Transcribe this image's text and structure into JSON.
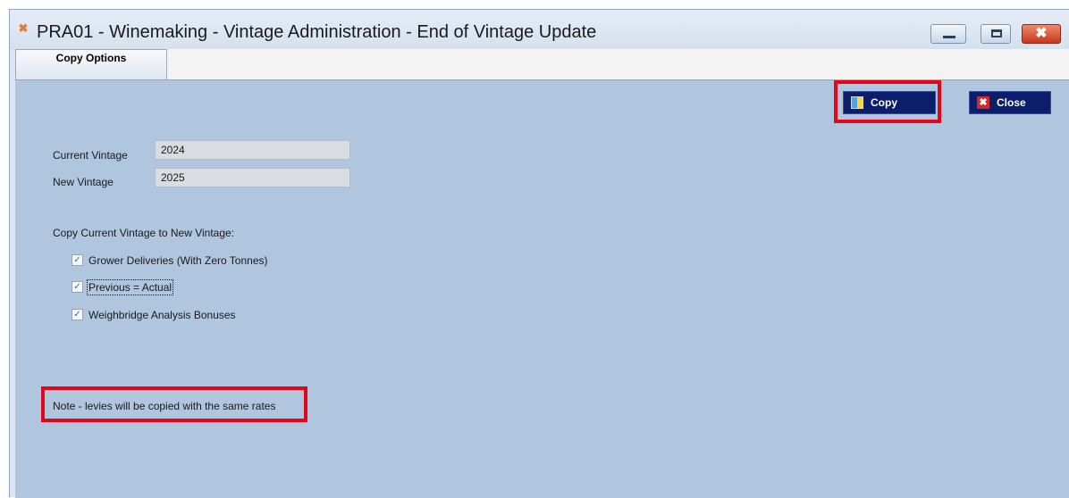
{
  "window": {
    "app_icon": "✖",
    "title": "PRA01 - Winemaking - Vintage Administration - End of Vintage Update",
    "close_glyph": "✖"
  },
  "tabs": [
    {
      "label": "Copy Options",
      "active": true
    }
  ],
  "toolbar": {
    "copy_label": "Copy",
    "close_label": "Close",
    "close_icon_glyph": "✖"
  },
  "form": {
    "current_vintage_label": "Current Vintage",
    "current_vintage_value": "2024",
    "new_vintage_label": "New Vintage",
    "new_vintage_value": "2025",
    "section_label": "Copy Current Vintage to New Vintage:"
  },
  "options": [
    {
      "label": "Grower Deliveries (With Zero Tonnes)",
      "checked": true,
      "mark": "✓"
    },
    {
      "label": "Previous = Actual",
      "checked": true,
      "mark": "✓"
    },
    {
      "label": "Weighbridge Analysis Bonuses",
      "checked": true,
      "mark": "✓"
    }
  ],
  "note": "Note - levies will be copied with the same rates",
  "colors": {
    "highlight": "#e3061b",
    "panel_background": "#b0c6df",
    "button_background": "#0b1d6b"
  }
}
